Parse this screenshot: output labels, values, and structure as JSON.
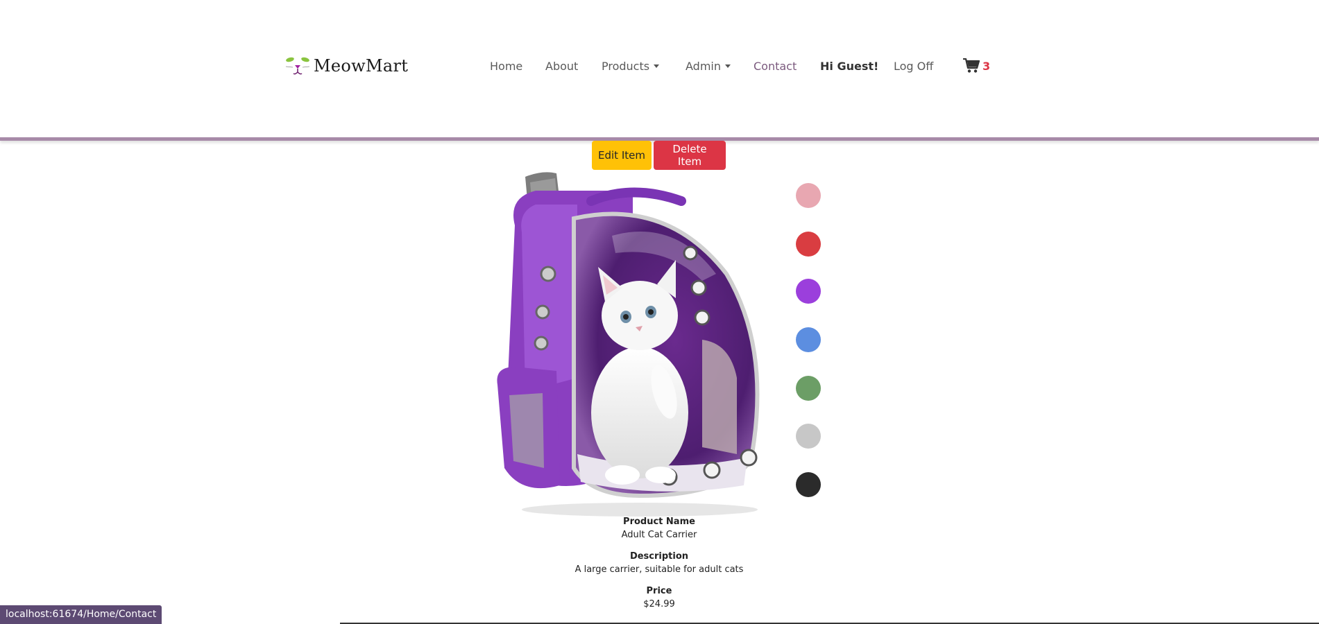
{
  "header": {
    "brand": "MeowMart",
    "nav": {
      "home": "Home",
      "about": "About",
      "products": "Products",
      "admin": "Admin",
      "contact": "Contact",
      "greeting": "Hi Guest!",
      "logoff": "Log Off"
    },
    "cart_count": "3",
    "cart_icon": "shopping-cart-icon",
    "accent_color": "#a78aa8"
  },
  "actions": {
    "edit_label": "Edit Item",
    "delete_label": "Delete Item"
  },
  "product": {
    "image": "purple cat carrier backpack with white kitten",
    "colors": [
      {
        "name": "pink",
        "hex": "#e8a7b1"
      },
      {
        "name": "red",
        "hex": "#d93d41"
      },
      {
        "name": "purple",
        "hex": "#9b3fdc"
      },
      {
        "name": "blue",
        "hex": "#5c8ee0"
      },
      {
        "name": "green",
        "hex": "#6c9e66"
      },
      {
        "name": "gray",
        "hex": "#c7c7c7"
      },
      {
        "name": "black",
        "hex": "#2b2b2b"
      }
    ],
    "name_label": "Product Name",
    "name": "Adult Cat Carrier",
    "description_label": "Description",
    "description": "A large carrier, suitable for adult cats",
    "price_label": "Price",
    "price": "$24.99"
  },
  "status_bar": {
    "url": "localhost:61674/Home/Contact"
  }
}
